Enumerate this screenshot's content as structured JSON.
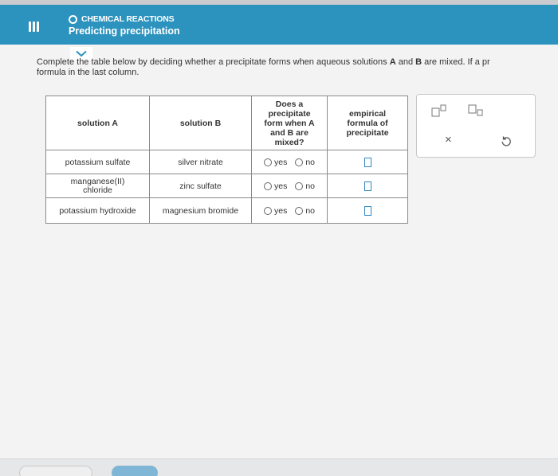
{
  "header": {
    "section": "CHEMICAL REACTIONS",
    "title": "Predicting precipitation"
  },
  "instructions": {
    "line1_pre": "Complete the table below by deciding whether a precipitate forms when aqueous solutions ",
    "var_a": "A",
    "line1_mid": " and ",
    "var_b": "B",
    "line1_post": " are mixed. If a pr",
    "line2": "formula in the last column."
  },
  "table": {
    "headers": {
      "solution_a": "solution A",
      "solution_b": "solution B",
      "precipitate": [
        "Does a",
        "precipitate",
        "form when A",
        "and B are",
        "mixed?"
      ],
      "formula": [
        "empirical",
        "formula of",
        "precipitate"
      ]
    },
    "radio_labels": {
      "yes": "yes",
      "no": "no"
    },
    "rows": [
      {
        "a": [
          "potassium sulfate"
        ],
        "b": "silver nitrate"
      },
      {
        "a": [
          "manganese(II)",
          "chloride"
        ],
        "b": "zinc sulfate"
      },
      {
        "a": [
          "potassium hydroxide"
        ],
        "b": "magnesium bromide"
      }
    ]
  },
  "toolbox": {
    "superscript": "superscript-tool",
    "subscript": "subscript-tool",
    "clear": "×",
    "undo": "undo-tool"
  },
  "colors": {
    "header_bg": "#2c93bf",
    "answer_box": "#2b86c5"
  }
}
